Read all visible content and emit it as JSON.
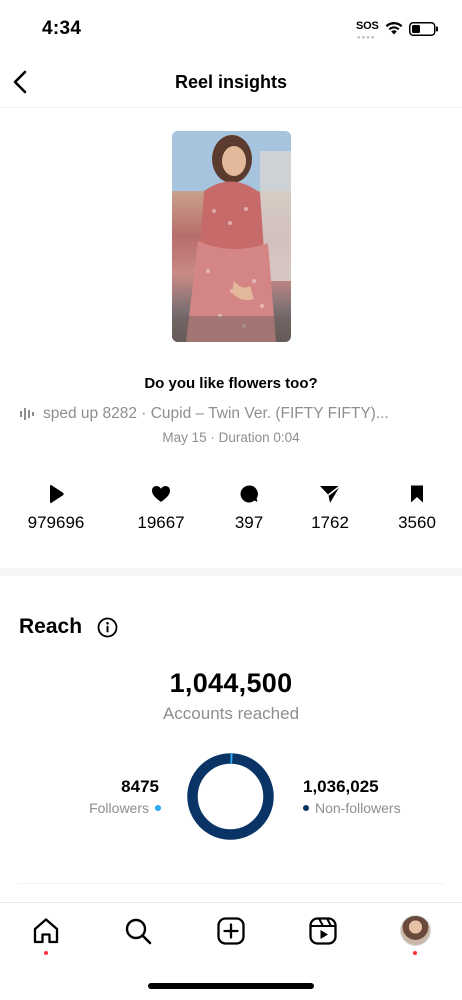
{
  "status_bar": {
    "time": "4:34",
    "sos": "SOS"
  },
  "nav": {
    "title": "Reel insights"
  },
  "reel": {
    "caption": "Do you like flowers too?",
    "audio": "sped up 8282 · Cupid – Twin Ver. (FIFTY FIFTY)...",
    "meta": "May 15 · Duration 0:04"
  },
  "stats": {
    "plays": "979696",
    "likes": "19667",
    "comments": "397",
    "shares": "1762",
    "saves": "3560"
  },
  "reach": {
    "title": "Reach",
    "total": "1,044,500",
    "subtitle": "Accounts reached",
    "followers_value": "8475",
    "followers_label": "Followers",
    "nonfollowers_value": "1,036,025",
    "nonfollowers_label": "Non-followers",
    "followers_fraction": 0.0081
  },
  "colors": {
    "followers": "#2aa8f5",
    "nonfollowers": "#0a3466",
    "muted_text": "#8e8e8e",
    "notification_dot": "#ff3040"
  },
  "icons": {
    "back": "chevron-left-icon",
    "plays": "play-icon",
    "likes": "heart-icon",
    "comments": "comment-bubble-icon",
    "shares": "paper-plane-icon",
    "saves": "bookmark-icon",
    "info": "info-icon",
    "tabs": [
      "home-icon",
      "search-icon",
      "create-icon",
      "reels-icon",
      "profile-avatar"
    ]
  }
}
